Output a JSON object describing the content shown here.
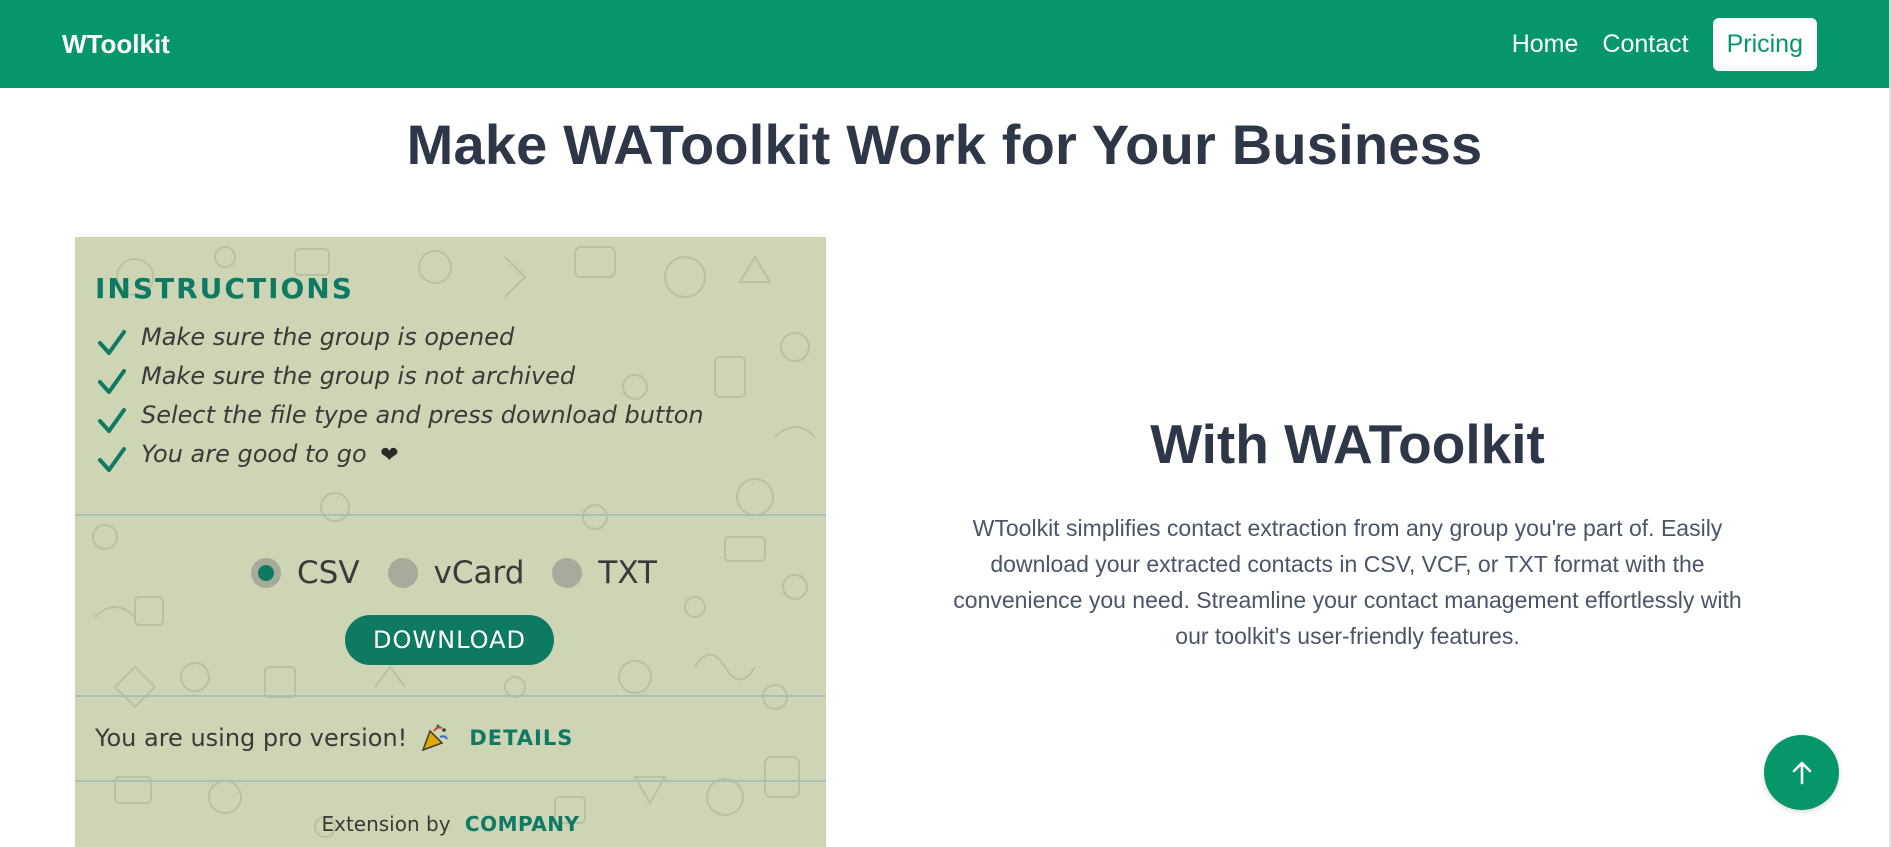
{
  "nav": {
    "brand": "WToolkit",
    "links": [
      "Home",
      "Contact"
    ],
    "cta": "Pricing"
  },
  "main": {
    "title": "Make WAToolkit Work for Your Business",
    "with_title": "With WAToolkit",
    "description": "WToolkit simplifies contact extraction from any group you're part of. Easily download your extracted contacts in CSV, VCF, or TXT format with the convenience you need. Streamline your contact management effortlessly with our toolkit's user-friendly features."
  },
  "mockup": {
    "instructions_title": "INSTRUCTIONS",
    "instructions": [
      "Make sure the group is opened",
      "Make sure the group is not archived",
      "Select the file type and press download button",
      "You are good to go"
    ],
    "formats": [
      "CSV",
      "vCard",
      "TXT"
    ],
    "selected_format": "CSV",
    "download_label": "DOWNLOAD",
    "pro_text": "You are using pro version!",
    "details_label": "DETAILS",
    "extension_by": "Extension by",
    "company": "COMPANY"
  },
  "icons": {
    "check": "check-icon",
    "heart": "heart-icon",
    "party": "party-popper-icon",
    "back_to_top": "arrow-up-icon"
  },
  "colors": {
    "brand_green": "#059669",
    "mock_background": "#cdd5b4",
    "mock_accent": "#0f7a64",
    "heading": "#2d3748"
  }
}
